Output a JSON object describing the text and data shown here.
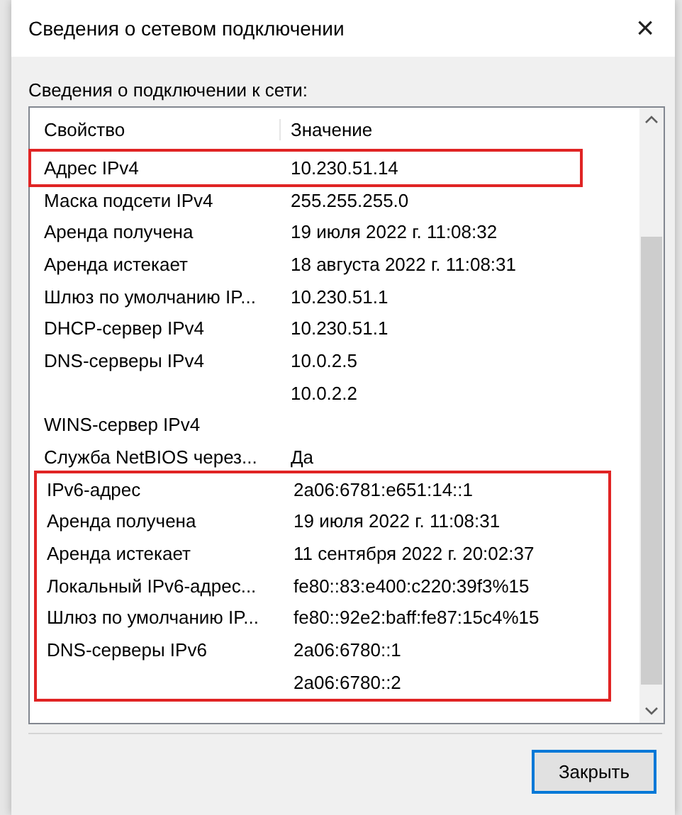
{
  "window": {
    "title": "Сведения о сетевом подключении",
    "close": "×"
  },
  "section_label": "Сведения о подключении к сети:",
  "table": {
    "columns": [
      "Свойство",
      "Значение"
    ],
    "row_groups": [
      {
        "highlighted": true,
        "rows": [
          {
            "property": "Адрес IPv4",
            "value": "10.230.51.14"
          }
        ]
      },
      {
        "highlighted": false,
        "rows": [
          {
            "property": "Маска подсети IPv4",
            "value": "255.255.255.0"
          },
          {
            "property": "Аренда получена",
            "value": "19 июля 2022 г. 11:08:32"
          },
          {
            "property": "Аренда истекает",
            "value": "18 августа 2022 г. 11:08:31"
          },
          {
            "property": "Шлюз по умолчанию IP...",
            "value": "10.230.51.1"
          },
          {
            "property": "DHCP-сервер IPv4",
            "value": "10.230.51.1"
          },
          {
            "property": "DNS-серверы IPv4",
            "value": "10.0.2.5"
          },
          {
            "property": "",
            "value": "10.0.2.2"
          },
          {
            "property": "WINS-сервер IPv4",
            "value": ""
          },
          {
            "property": "Служба NetBIOS через...",
            "value": "Да"
          }
        ]
      },
      {
        "highlighted": true,
        "rows": [
          {
            "property": "IPv6-адрес",
            "value": "2a06:6781:e651:14::1"
          },
          {
            "property": "Аренда получена",
            "value": "19 июля 2022 г. 11:08:31"
          },
          {
            "property": "Аренда истекает",
            "value": "11 сентября 2022 г. 20:02:37"
          },
          {
            "property": "Локальный IPv6-адрес...",
            "value": "fe80::83:e400:c220:39f3%15"
          },
          {
            "property": "Шлюз по умолчанию IP...",
            "value": "fe80::92e2:baff:fe87:15c4%15"
          },
          {
            "property": "DNS-серверы IPv6",
            "value": "2a06:6780::1"
          },
          {
            "property": "",
            "value": "2a06:6780::2"
          }
        ]
      }
    ]
  },
  "buttons": [
    {
      "label": "Закрыть",
      "kind": "default"
    }
  ]
}
